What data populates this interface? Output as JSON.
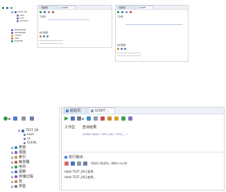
{
  "top_mini": {
    "tree": {
      "server": "TEST_66",
      "children": [
        "sash",
        "CAS",
        "SVCOUT"
      ],
      "groups": [
        {
          "label": "RADIATION",
          "color": "#6a7bd8"
        },
        {
          "label": "ASD4WIRE",
          "color": "#8b5fbf"
        },
        {
          "label": "TSVTX",
          "color": "#e0a030"
        },
        {
          "label": "VMS",
          "color": "#d46a6a"
        },
        {
          "label": "RASTER",
          "color": "#3aa35a"
        }
      ]
    },
    "window1": {
      "tabs": [
        "数据库",
        "SCRIPT"
      ],
      "section": "工作区",
      "results_label": "执行结果"
    },
    "window2": {
      "tabs": [
        "数据库",
        "SCRIPT"
      ],
      "section": "工作区",
      "results_label": "执行结果"
    }
  },
  "main": {
    "tree": {
      "root_label": "TEST_66",
      "sub_items": [
        "sash",
        "cx",
        "SCEIN"
      ],
      "categories": [
        {
          "label": "表草",
          "icon": "table-icon"
        },
        {
          "label": "视图",
          "icon": "view-icon"
        },
        {
          "label": "索引",
          "icon": "index-icon"
        },
        {
          "label": "触发器",
          "icon": "trigger-icon"
        },
        {
          "label": "序列",
          "icon": "sequence-icon"
        },
        {
          "label": "函数",
          "icon": "function-icon"
        },
        {
          "label": "存储过程",
          "icon": "procedure-icon"
        },
        {
          "label": "包",
          "icon": "package-icon"
        },
        {
          "label": "类型",
          "icon": "type-icon"
        }
      ]
    },
    "editor": {
      "tabs": [
        "起始页",
        "SCRIPT"
      ],
      "work_area_label": "工作区",
      "results_label": "查询结果",
      "sql_text": "ALTER TABLE \"TEST_66\".\"TEST_...\""
    },
    "output": {
      "title": "执行输出",
      "status_text": "共执行1条语句，耗时0.002秒",
      "lines": [
        "table TEST_66已变更。",
        "table TEST_66已变更。"
      ]
    }
  }
}
